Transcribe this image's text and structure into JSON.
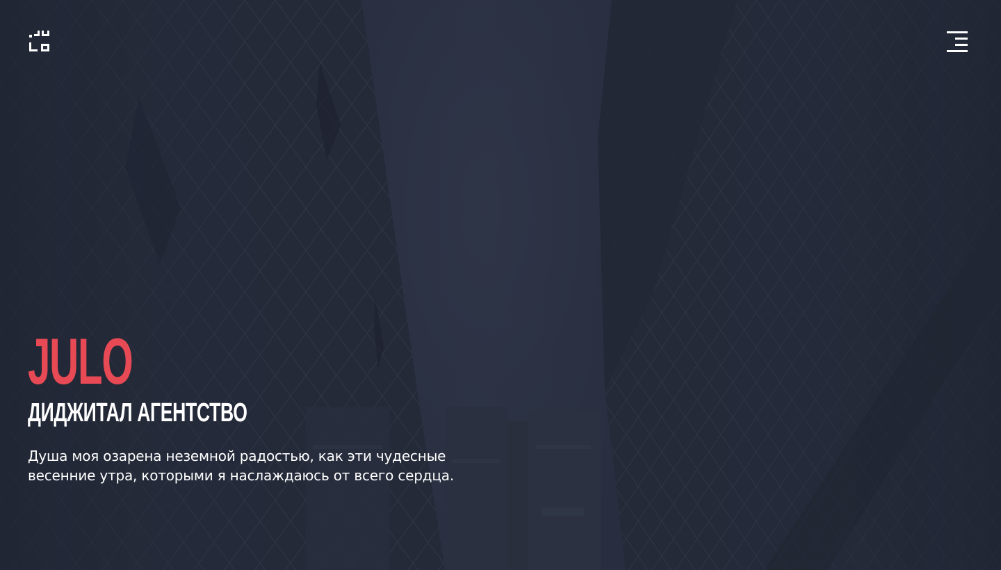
{
  "header": {
    "logo_icon": "julo-logo-icon",
    "menu_icon": "hamburger-menu-icon"
  },
  "hero": {
    "brand": "JULO",
    "tagline": "ДИДЖИТАЛ АГЕНТСТВО",
    "description": "Душа моя озарена неземной радостью, как эти чудесные весенние утра, которыми я наслаждаюсь от всего сердца."
  },
  "colors": {
    "accent": "#e84a55",
    "text": "#ffffff",
    "background": "#2b3142"
  }
}
